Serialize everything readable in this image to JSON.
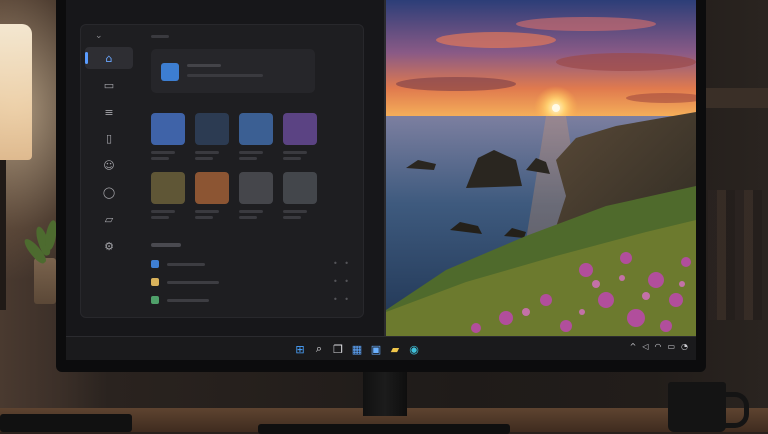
{
  "sidebar": {
    "items": [
      {
        "name": "home",
        "icon": "home-icon",
        "glyph": "⌂",
        "active": true
      },
      {
        "name": "display",
        "icon": "monitor-icon",
        "glyph": "▭"
      },
      {
        "name": "list",
        "icon": "list-icon",
        "glyph": "≡"
      },
      {
        "name": "document",
        "icon": "document-icon",
        "glyph": "▯"
      },
      {
        "name": "profile",
        "icon": "user-icon",
        "glyph": "☺"
      },
      {
        "name": "messages",
        "icon": "chat-bubble-icon",
        "glyph": "◯"
      },
      {
        "name": "folder",
        "icon": "folder-icon",
        "glyph": "▱"
      },
      {
        "name": "settings",
        "icon": "gear-icon",
        "glyph": "⚙"
      }
    ],
    "collapse_glyph": "⌄"
  },
  "tiles": [
    {
      "color": "#3f63a8"
    },
    {
      "color": "#2c3b52"
    },
    {
      "color": "#3b5f93"
    },
    {
      "color": "#5b4383"
    },
    {
      "color": "#5f5636"
    },
    {
      "color": "#8c5533"
    },
    {
      "color": "#45464b"
    },
    {
      "color": "#43464b"
    }
  ],
  "list_rows": [
    {
      "color": "#3f7fd4",
      "more_glyph": "• •"
    },
    {
      "color": "#d9b25b",
      "more_glyph": "• •"
    },
    {
      "color": "#4fa06a",
      "more_glyph": "• •"
    }
  ],
  "taskbar": {
    "icons": [
      {
        "name": "start",
        "icon": "windows-logo-icon",
        "glyph": "⊞",
        "color": "#4aa3ff"
      },
      {
        "name": "search",
        "icon": "search-icon",
        "glyph": "⌕",
        "color": "#e0e0e4"
      },
      {
        "name": "task-view",
        "icon": "task-view-icon",
        "glyph": "❐",
        "color": "#e0e0e4"
      },
      {
        "name": "widgets",
        "icon": "widgets-icon",
        "glyph": "▦",
        "color": "#5fa8ff"
      },
      {
        "name": "store",
        "icon": "store-icon",
        "glyph": "▣",
        "color": "#6ab0ff"
      },
      {
        "name": "file-explorer",
        "icon": "folder-icon",
        "glyph": "▰",
        "color": "#f0c64a"
      },
      {
        "name": "edge",
        "icon": "edge-browser-icon",
        "glyph": "◉",
        "color": "#3fbfd8"
      }
    ],
    "tray": [
      {
        "name": "chevron-up",
        "icon": "chevron-up-icon",
        "glyph": "^"
      },
      {
        "name": "volume",
        "icon": "speaker-icon",
        "glyph": "◁"
      },
      {
        "name": "wifi",
        "icon": "wifi-icon",
        "glyph": "◠"
      },
      {
        "name": "battery",
        "icon": "battery-icon",
        "glyph": "▭"
      },
      {
        "name": "notifications",
        "icon": "notification-icon",
        "glyph": "◔"
      }
    ]
  }
}
